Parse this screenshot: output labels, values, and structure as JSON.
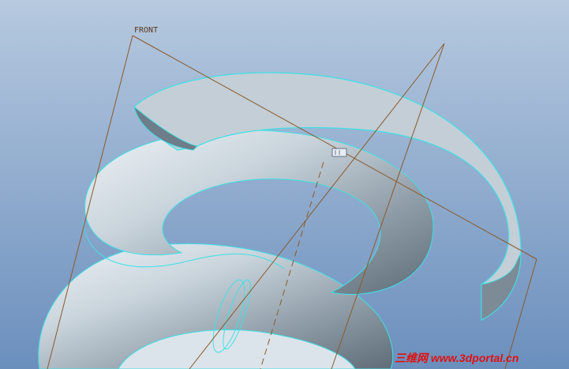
{
  "viewport": {
    "datum_plane_label": "FRONT",
    "watermark_text": "三维网 www.3dportal.cn"
  },
  "colors": {
    "background_top": "#a9bfd9",
    "background_bottom": "#6f93bf",
    "model_surface": "#c2ced6",
    "edge_highlight": "#3fe0e6",
    "datum_plane": "#8a5a2a",
    "watermark": "#e01010"
  },
  "icons": {
    "datum_marker": "csys-marker-icon"
  }
}
